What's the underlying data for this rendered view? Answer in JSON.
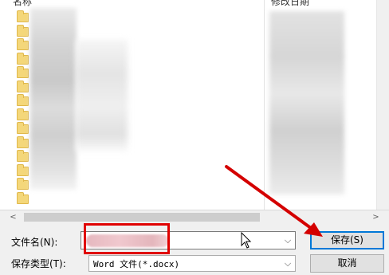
{
  "list": {
    "col_name": "名称",
    "col_date": "修改日期",
    "folder_count": 14
  },
  "scroll": {
    "left_arrow": "<",
    "right_arrow": ">"
  },
  "form": {
    "filename_label": "文件名(N):",
    "filetype_label": "保存类型(T):",
    "filetype_value": "Word 文件(*.docx)",
    "dropdown_glyph": "⌵"
  },
  "buttons": {
    "save": "保存(S)",
    "cancel": "取消"
  },
  "colors": {
    "accent": "#0078d7",
    "annotation": "#e00000",
    "folder": "#f4d77a"
  }
}
